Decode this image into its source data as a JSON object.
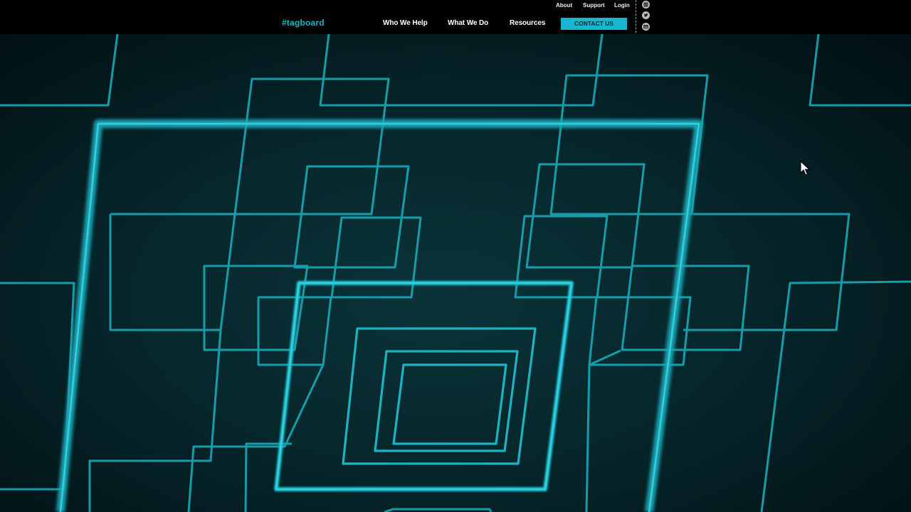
{
  "header": {
    "logo": "#tagboard",
    "utility_nav": [
      {
        "label": "About"
      },
      {
        "label": "Support"
      },
      {
        "label": "Login"
      }
    ],
    "main_nav": [
      {
        "label": "Who We Help"
      },
      {
        "label": "What We Do"
      },
      {
        "label": "Resources"
      }
    ],
    "contact_label": "CONTACT US",
    "social_icons": [
      "instagram-icon",
      "twitter-icon",
      "email-icon"
    ]
  },
  "hero": {
    "background": "animated teal line-art tunnel",
    "line_color": "#19a9b8"
  },
  "colors": {
    "accent": "#16b7cf",
    "header_bg": "#000000",
    "hero_bg": "#06272c"
  }
}
